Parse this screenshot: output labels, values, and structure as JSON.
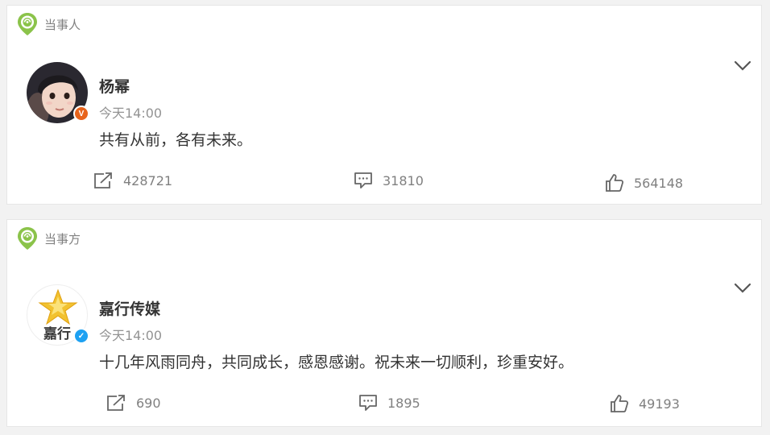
{
  "posts": [
    {
      "tag": "当事人",
      "author": "杨幂",
      "badge": "V",
      "time": "今天14:00",
      "content": "共有从前，各有未来。",
      "reposts": "428721",
      "comments": "31810",
      "likes": "564148",
      "badge_color": "#e8641c"
    },
    {
      "tag": "当事方",
      "author": "嘉行传媒",
      "avatar_text": "嘉行",
      "badge": "✓",
      "time": "今天14:00",
      "content": "十几年风雨同舟，共同成长，感恩感谢。祝未来一切顺利，珍重安好。",
      "reposts": "690",
      "comments": "1895",
      "likes": "49193",
      "badge_color": "#1da1f2"
    }
  ],
  "colors": {
    "tag_green": "#8bc34a",
    "text_primary": "#333333",
    "text_secondary": "#939393",
    "background": "#f2f2f2"
  }
}
